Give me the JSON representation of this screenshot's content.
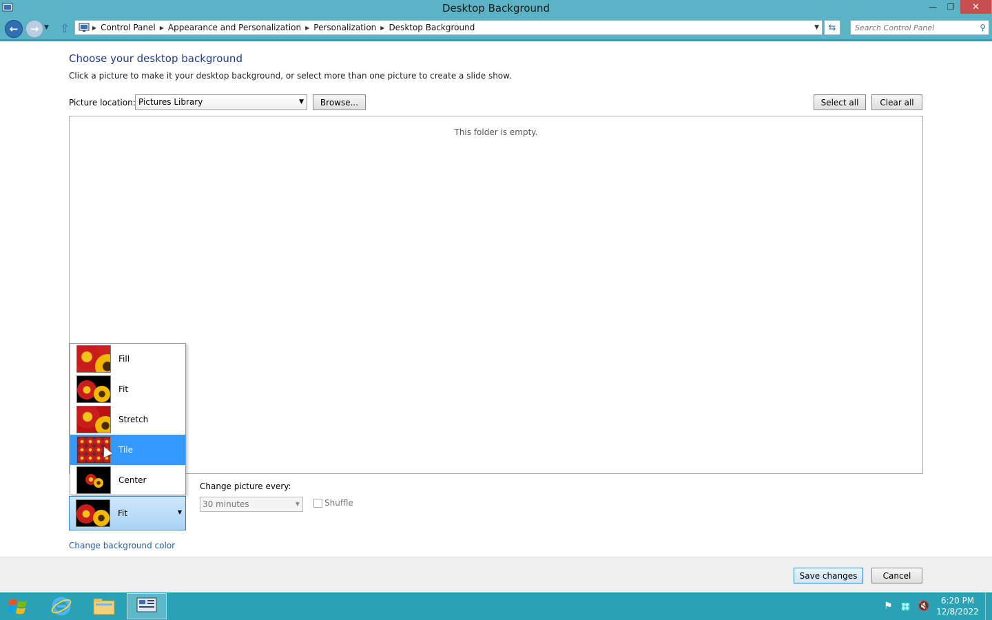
{
  "window": {
    "title": "Desktop Background"
  },
  "breadcrumbs": [
    "Control Panel",
    "Appearance and Personalization",
    "Personalization",
    "Desktop Background"
  ],
  "search": {
    "placeholder": "Search Control Panel"
  },
  "main": {
    "heading": "Choose your desktop background",
    "subheading": "Click a picture to make it your desktop background, or select more than one picture to create a slide show.",
    "picture_location_label": "Picture location:",
    "picture_location_value": "Pictures Library",
    "browse_label": "Browse...",
    "select_all_label": "Select all",
    "clear_all_label": "Clear all",
    "empty_message": "This folder is empty."
  },
  "picture_position": {
    "options": [
      "Fill",
      "Fit",
      "Stretch",
      "Tile",
      "Center"
    ],
    "highlighted": "Tile",
    "selected": "Fit"
  },
  "slideshow": {
    "change_label": "Change picture every:",
    "interval_value": "30 minutes",
    "shuffle_label": "Shuffle",
    "shuffle_checked": false
  },
  "change_background_color_label": "Change background color",
  "footer": {
    "save_label": "Save changes",
    "cancel_label": "Cancel"
  },
  "taskbar": {
    "time": "6:20 PM",
    "date": "12/8/2022"
  },
  "colors": {
    "accent": "#5bb4c6",
    "taskbar": "#2aa1b4",
    "selection": "#3399ff",
    "link": "#1f5fa8",
    "heading": "#1e3a8a"
  }
}
